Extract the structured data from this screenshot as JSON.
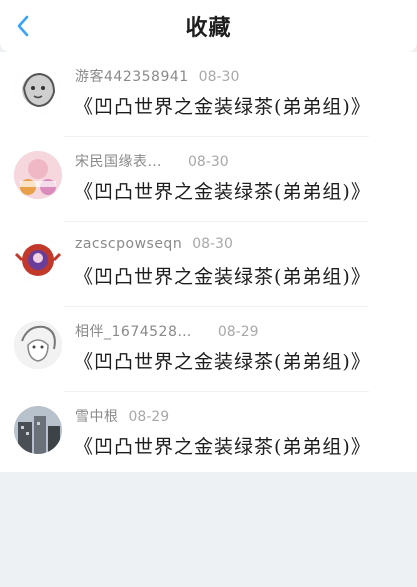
{
  "header": {
    "title": "收藏",
    "accent": "#3aa3f5"
  },
  "favorites": [
    {
      "user": "游客442358941",
      "date": "08-30",
      "text": "《凹凸世界之金装绿茶(弟弟组)》",
      "avatar_icon": "lion-avatar"
    },
    {
      "user": "宋民国缘表…",
      "date": "08-30",
      "text": "《凹凸世界之金装绿茶(弟弟组)》",
      "avatar_icon": "character-avatar"
    },
    {
      "user": "zacscpowseqn",
      "date": "08-30",
      "text": "《凹凸世界之金装绿茶(弟弟组)》",
      "avatar_icon": "badge-avatar"
    },
    {
      "user": "相伴_1674528…",
      "date": "08-29",
      "text": "《凹凸世界之金装绿茶(弟弟组)》",
      "avatar_icon": "sketch-avatar"
    },
    {
      "user": "雪中根",
      "date": "08-29",
      "text": "《凹凸世界之金装绿茶(弟弟组)》",
      "avatar_icon": "building-avatar"
    }
  ]
}
